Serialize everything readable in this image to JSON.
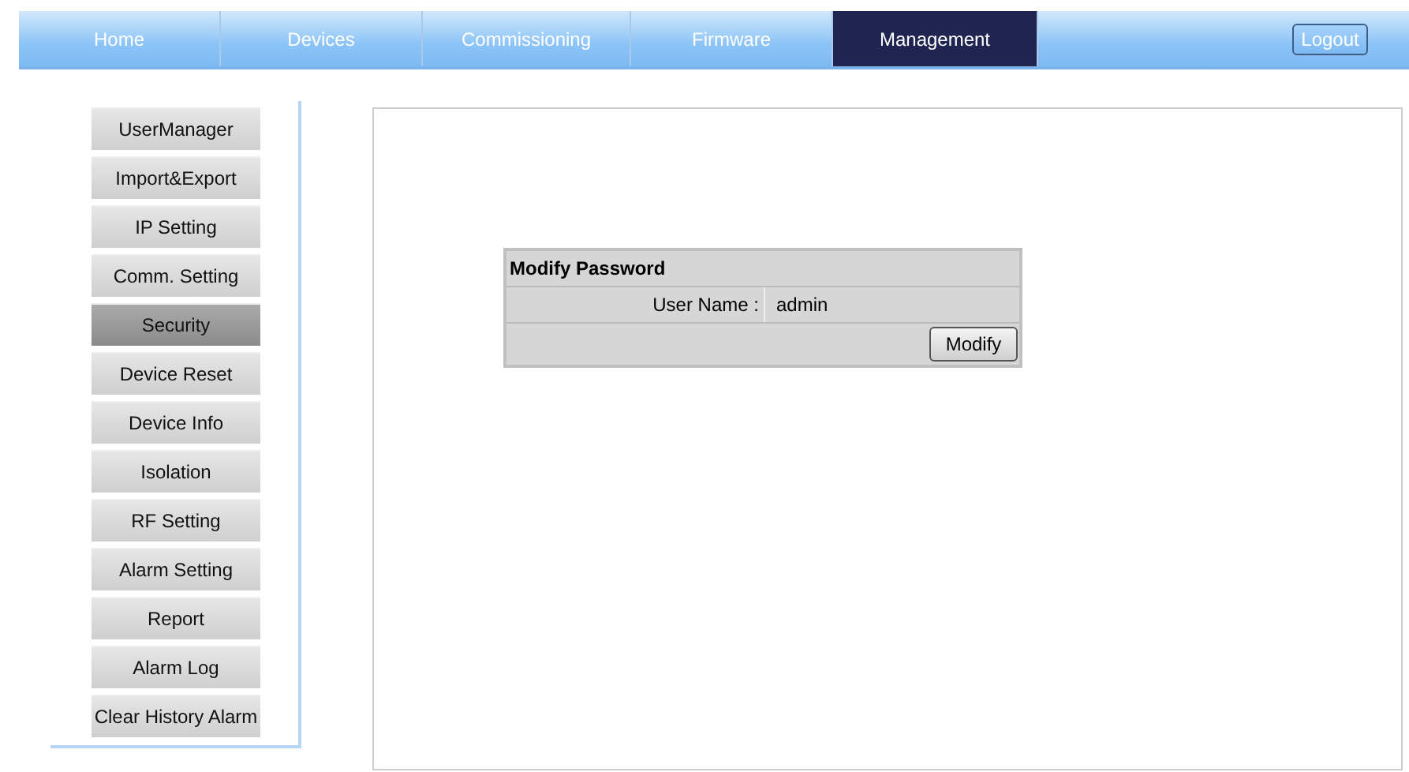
{
  "nav": {
    "tabs": [
      {
        "label": "Home",
        "selected": false
      },
      {
        "label": "Devices",
        "selected": false
      },
      {
        "label": "Commissioning",
        "selected": false
      },
      {
        "label": "Firmware",
        "selected": false
      },
      {
        "label": "Management",
        "selected": true
      }
    ],
    "logout": "Logout"
  },
  "sidebar": {
    "items": [
      {
        "label": "UserManager",
        "selected": false
      },
      {
        "label": "Import&Export",
        "selected": false
      },
      {
        "label": "IP Setting",
        "selected": false
      },
      {
        "label": "Comm. Setting",
        "selected": false
      },
      {
        "label": "Security",
        "selected": true
      },
      {
        "label": "Device Reset",
        "selected": false
      },
      {
        "label": "Device Info",
        "selected": false
      },
      {
        "label": "Isolation",
        "selected": false
      },
      {
        "label": "RF Setting",
        "selected": false
      },
      {
        "label": "Alarm Setting",
        "selected": false
      },
      {
        "label": "Report",
        "selected": false
      },
      {
        "label": "Alarm Log",
        "selected": false
      },
      {
        "label": "Clear History Alarm",
        "selected": false
      }
    ]
  },
  "form": {
    "title": "Modify Password",
    "fields": [
      {
        "label": "User Name :",
        "value": "admin"
      }
    ],
    "button": "Modify"
  }
}
